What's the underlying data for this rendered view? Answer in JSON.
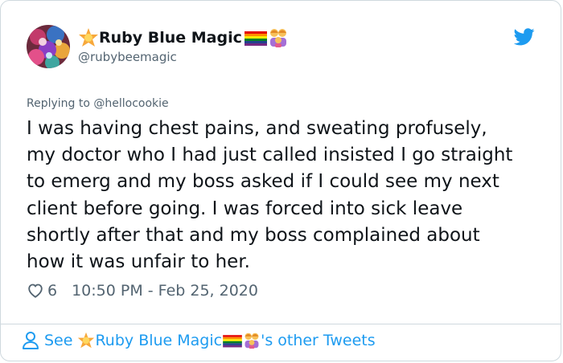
{
  "tweet": {
    "author": {
      "name": "Ruby Blue Magic",
      "handle": "@rubybeemagic"
    },
    "reply_prefix": "Replying to ",
    "reply_to": "@hellocookie",
    "text": "I was having chest pains, and sweating profusely,\nmy doctor who I had just called insisted I go straight\nto emerg and my boss asked if I could see my next\nclient before going. I was forced into sick leave\nshortly after that and my boss complained about\nhow it was unfair to her.",
    "likes": "6",
    "timestamp": "10:50 PM - Feb 25, 2020"
  },
  "footer": {
    "see_label": "See",
    "author_name": "Ruby Blue Magic",
    "suffix": "'s other Tweets"
  },
  "icons": {
    "star": "star-emoji-icon",
    "rainbow": "rainbow-flag-icon",
    "family": "family-emoji-icon",
    "twitter": "twitter-bird-icon",
    "heart": "heart-icon",
    "person": "person-icon"
  },
  "colors": {
    "accent": "#1d9bf0",
    "secondary_text": "#536471",
    "text": "#0f1419",
    "border": "#cfd9de"
  }
}
